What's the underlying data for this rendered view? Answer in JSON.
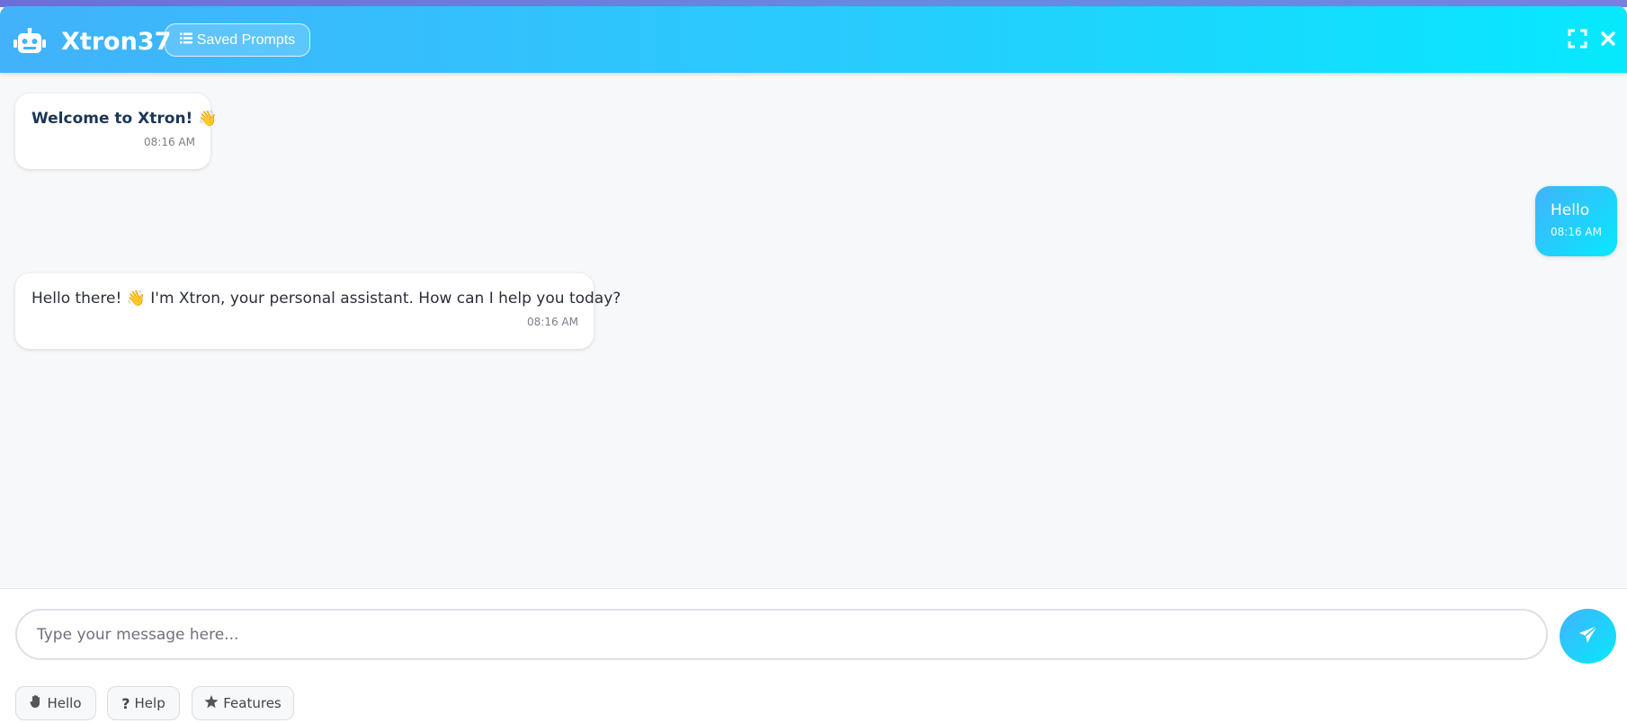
{
  "header": {
    "title": "Xtron37",
    "saved_prompts_label": "Saved Prompts"
  },
  "messages": [
    {
      "role": "bot",
      "text": "Welcome to Xtron! 👋",
      "time": "08:16 AM"
    },
    {
      "role": "user",
      "text": "Hello",
      "time": "08:16 AM"
    },
    {
      "role": "bot",
      "text": "Hello there! 👋 I'm Xtron, your personal assistant. How can I help you today?",
      "time": "08:16 AM"
    }
  ],
  "composer": {
    "placeholder": "Type your message here...",
    "value": ""
  },
  "quick_replies": [
    {
      "label": "Hello",
      "icon": "hand-icon"
    },
    {
      "label": "Help",
      "icon": "question-icon"
    },
    {
      "label": "Features",
      "icon": "star-icon"
    }
  ],
  "icons": {
    "logo": "robot-icon",
    "saved_prompts": "list-icon",
    "expand": "expand-icon",
    "close": "close-icon",
    "send": "paper-plane-icon"
  },
  "colors": {
    "accent_start": "#42b2fb",
    "accent_end": "#06e9fd",
    "background": "#f7f8fa"
  }
}
